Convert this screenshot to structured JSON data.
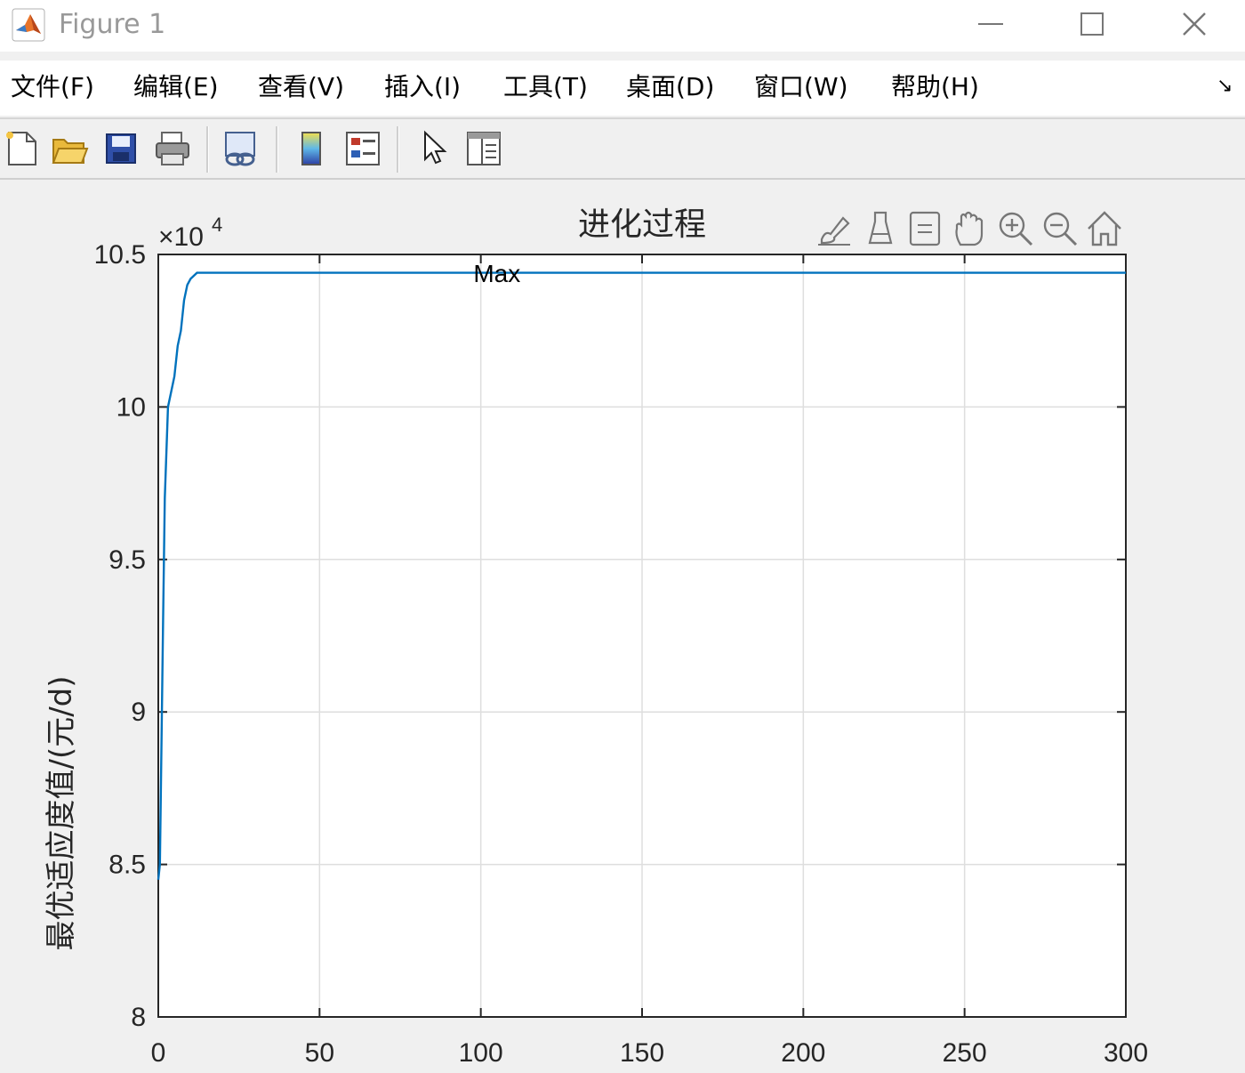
{
  "window": {
    "title": "Figure 1"
  },
  "menu": {
    "items": [
      {
        "label": "文件(F)"
      },
      {
        "label": "编辑(E)"
      },
      {
        "label": "查看(V)"
      },
      {
        "label": "插入(I)"
      },
      {
        "label": "工具(T)"
      },
      {
        "label": "桌面(D)"
      },
      {
        "label": "窗口(W)"
      },
      {
        "label": "帮助(H)"
      }
    ]
  },
  "toolbar": {
    "icons": [
      "new-figure-icon",
      "open-file-icon",
      "save-icon",
      "print-icon",
      "link-plot-icon",
      "colorbar-icon",
      "legend-icon",
      "pointer-icon",
      "property-inspector-icon"
    ]
  },
  "axes_toolbar": {
    "icons": [
      "brush-icon",
      "data-tips-icon",
      "rotate-icon",
      "pan-icon",
      "zoom-in-icon",
      "zoom-out-icon",
      "home-icon"
    ]
  },
  "chart_data": {
    "type": "line",
    "title": "进化过程",
    "xlabel": "",
    "ylabel": "最优适应度值/(元/d)",
    "y_exponent_label": "×10",
    "y_exponent_power": "4",
    "xlim": [
      0,
      300
    ],
    "ylim": [
      8,
      10.5
    ],
    "xticks": [
      "0",
      "50",
      "100",
      "150",
      "200",
      "250",
      "300"
    ],
    "yticks": [
      "8",
      "8.5",
      "9",
      "9.5",
      "10",
      "10.5"
    ],
    "grid": true,
    "line_color": "#0072BD",
    "series": [
      {
        "x": [
          0,
          0.5,
          1,
          1.5,
          2,
          3,
          4,
          5,
          6,
          7,
          8,
          9,
          10,
          12,
          15,
          20,
          50,
          100,
          150,
          200,
          250,
          300
        ],
        "y": [
          8.45,
          8.5,
          8.9,
          9.3,
          9.7,
          10.0,
          10.05,
          10.1,
          10.2,
          10.25,
          10.35,
          10.4,
          10.42,
          10.44,
          10.44,
          10.44,
          10.44,
          10.44,
          10.44,
          10.44,
          10.44,
          10.44
        ]
      }
    ],
    "annotations": [
      {
        "text": "Max",
        "x": 105,
        "y": 10.41
      }
    ]
  }
}
